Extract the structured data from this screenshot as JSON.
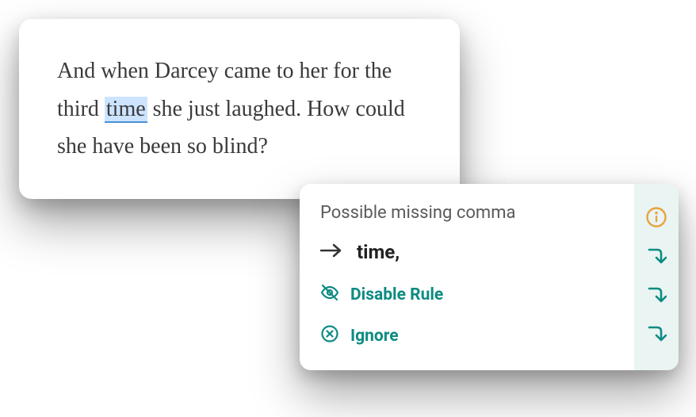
{
  "text_card": {
    "before": "And when Darcey came to her for the third ",
    "highlight": "time",
    "after": " she just laughed. How could she have been so blind?"
  },
  "popup": {
    "title": "Possible missing comma",
    "suggestion": "time,",
    "disable_label": "Disable Rule",
    "ignore_label": "Ignore"
  }
}
